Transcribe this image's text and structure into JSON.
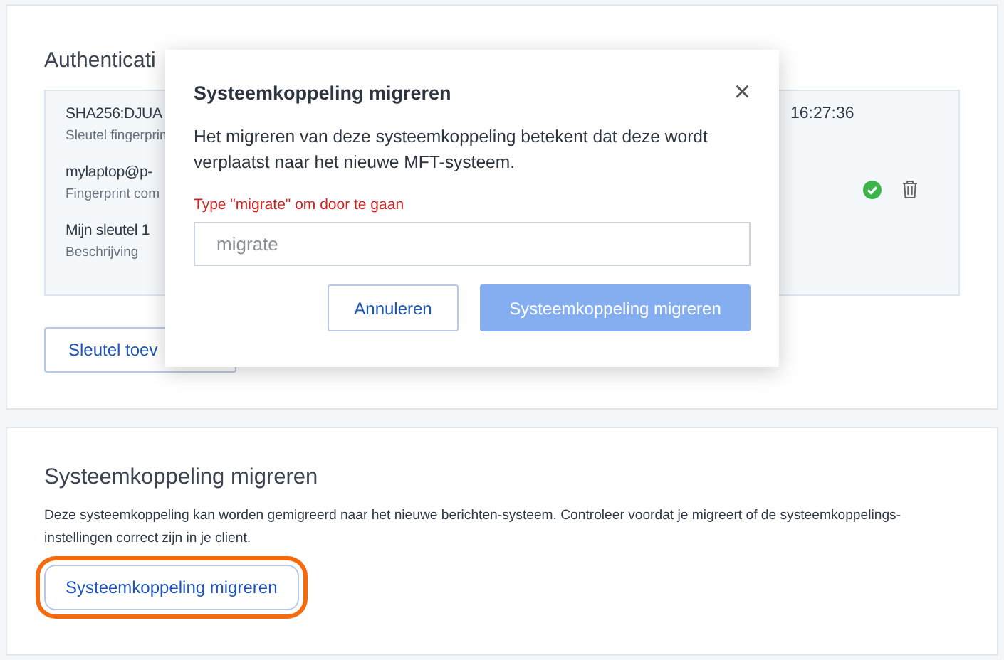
{
  "auth_section": {
    "title": "Authenticati",
    "key_card": {
      "fields": [
        {
          "value": "SHA256:DJUA",
          "label": "Sleutel fingerprin"
        },
        {
          "value": "mylaptop@p-",
          "label": "Fingerprint com"
        },
        {
          "value": "Mijn sleutel 1",
          "label": "Beschrijving"
        }
      ],
      "timestamp": "16:27:36",
      "verified": true
    },
    "add_button": "Sleutel toev"
  },
  "migrate_section": {
    "title": "Systeemkoppeling migreren",
    "description": "Deze systeemkoppeling kan worden gemigreerd naar het nieuwe berichten-systeem. Controleer voordat je migreert of de systeemkoppelings-instellingen correct zijn in je client.",
    "button": {
      "label": "Systeemkoppeling migreren",
      "focused": true
    }
  },
  "dialog": {
    "title": "Systeemkoppeling migreren",
    "close": "×",
    "message": "Het migreren van deze systeemkoppeling betekent dat deze wordt verplaatst naar het nieuwe MFT-systeem.",
    "field_label": "Type \"migrate\" om door te gaan",
    "field": {
      "placeholder": "migrate"
    },
    "buttons": [
      {
        "label": "Annuleren",
        "kind": "secondary",
        "disabled": false
      },
      {
        "label": "Systeemkoppeling migreren",
        "kind": "primary",
        "disabled": true
      }
    ]
  }
}
